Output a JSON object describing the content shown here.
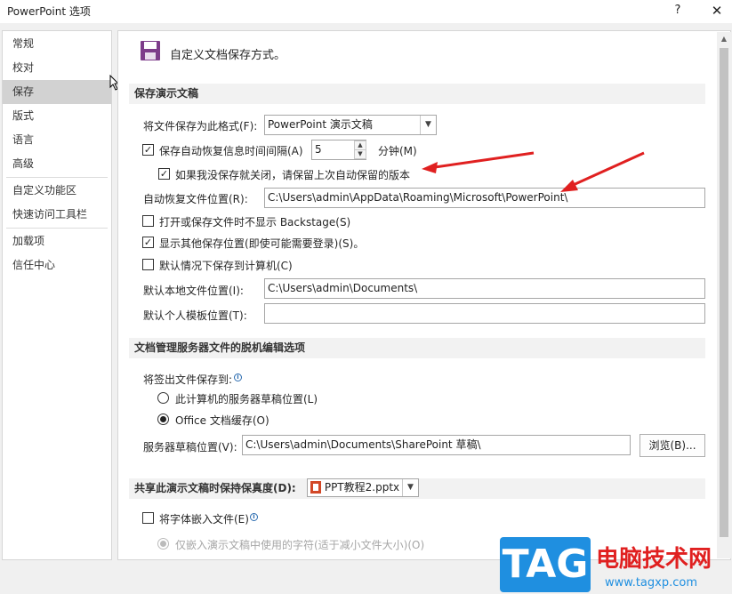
{
  "window": {
    "title": "PowerPoint 选项",
    "help": "?",
    "close": "✕"
  },
  "sidebar": {
    "items": [
      "常规",
      "校对",
      "保存",
      "版式",
      "语言",
      "高级",
      "自定义功能区",
      "快速访问工具栏",
      "加载项",
      "信任中心"
    ],
    "selected": "保存"
  },
  "header": {
    "text": "自定义文档保存方式。"
  },
  "section1": {
    "title": "保存演示文稿",
    "format_label": "将文件保存为此格式(F):",
    "format_value": "PowerPoint 演示文稿",
    "autorecover_label": "保存自动恢复信息时间间隔(A)",
    "autorecover_checked": true,
    "autorecover_minutes": "5",
    "minutes_label": "分钟(M)",
    "keep_last_label": "如果我没保存就关闭，请保留上次自动保留的版本",
    "keep_last_checked": true,
    "autorecover_location_label": "自动恢复文件位置(R):",
    "autorecover_location_value": "C:\\Users\\admin\\AppData\\Roaming\\Microsoft\\PowerPoint\\",
    "backstage_label": "打开或保存文件时不显示 Backstage(S)",
    "backstage_checked": false,
    "show_locations_label": "显示其他保存位置(即使可能需要登录)(S)。",
    "show_locations_checked": true,
    "default_computer_label": "默认情况下保存到计算机(C)",
    "default_computer_checked": false,
    "local_location_label": "默认本地文件位置(I):",
    "local_location_value": "C:\\Users\\admin\\Documents\\",
    "template_location_label": "默认个人模板位置(T):",
    "template_location_value": ""
  },
  "section2": {
    "title": "文档管理服务器文件的脱机编辑选项",
    "checkout_label": "将签出文件保存到:",
    "info_icon": "info-icon",
    "radio_server_label": "此计算机的服务器草稿位置(L)",
    "radio_cache_label": "Office 文档缓存(O)",
    "selected_radio": "cache",
    "drafts_label": "服务器草稿位置(V):",
    "drafts_value": "C:\\Users\\admin\\Documents\\SharePoint 草稿\\",
    "browse_label": "浏览(B)..."
  },
  "section3": {
    "title": "共享此演示文稿时保持保真度(D):",
    "file_value": "PPT教程2.pptx",
    "embed_fonts_label": "将字体嵌入文件(E)",
    "embed_fonts_checked": false,
    "embed_only_used_label": "仅嵌入演示文稿中使用的字符(适于减小文件大小)(O)"
  },
  "colors": {
    "accent_arrow": "#e02020",
    "save_icon": "#7d3c8a",
    "selected_bg": "#d2d2d2"
  },
  "watermark": {
    "logo_text": "TAG",
    "site_name": "电脑技术网",
    "site_url": "www.tagxp.com"
  }
}
